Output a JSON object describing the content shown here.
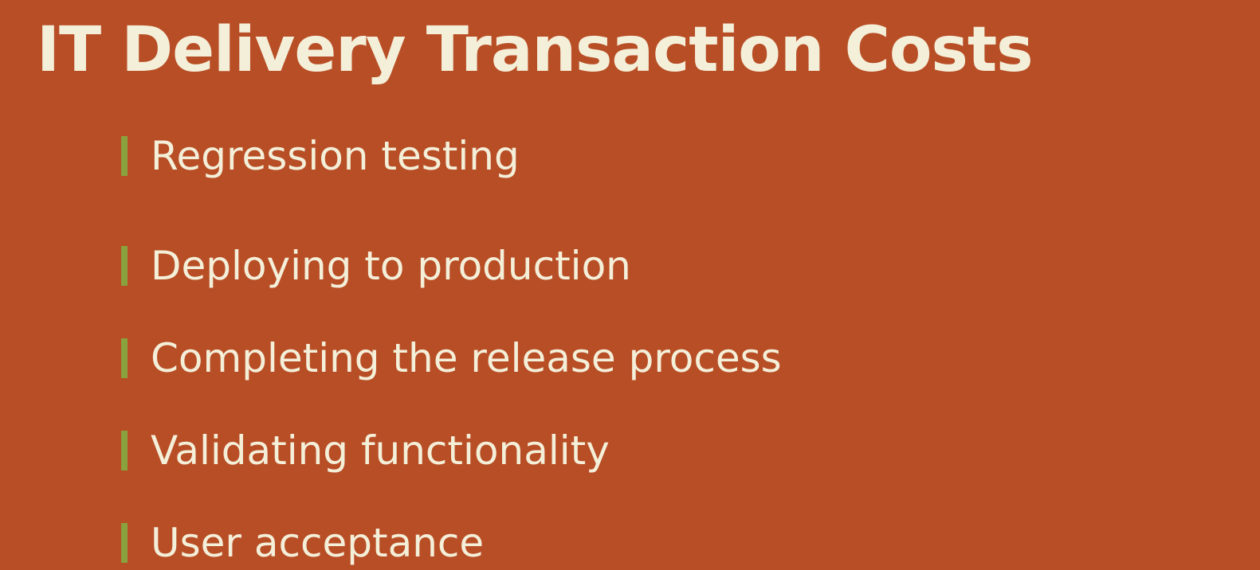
{
  "slide": {
    "title": "IT Delivery Transaction Costs",
    "bullets": [
      "Regression testing",
      "Deploying to production",
      "Completing the release process",
      "Validating functionality",
      "User acceptance"
    ]
  },
  "colors": {
    "background": "#b84e26",
    "text": "#f4efd9",
    "bullet_marker": "#8aa23d"
  }
}
